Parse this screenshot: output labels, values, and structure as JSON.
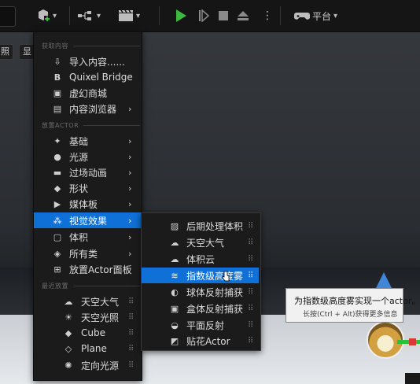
{
  "toolbar": {
    "items": [
      {
        "icon": "add-actor-icon"
      },
      {
        "icon": "blueprint-icon"
      },
      {
        "icon": "cinematics-icon"
      }
    ],
    "play_controls": [
      "play-icon",
      "step-icon",
      "stop-icon",
      "eject-icon",
      "more-options-icon"
    ],
    "platforms_label": "平台"
  },
  "viewport_buttons": [
    "照",
    "显"
  ],
  "main_menu": {
    "sections": {
      "get_content": "获取内容",
      "place_actor": "放置ACTOR",
      "recently_placed": "最近放置"
    },
    "get_content_items": [
      {
        "label": "导入内容......",
        "icon": "import-icon"
      },
      {
        "label": "Quixel Bridge",
        "icon": "bridge-icon"
      },
      {
        "label": "虚幻商城",
        "icon": "marketplace-icon"
      },
      {
        "label": "内容浏览器",
        "icon": "content-browser-icon",
        "has_submenu": true
      }
    ],
    "place_actor_items": [
      {
        "label": "基础",
        "icon": "basic-icon",
        "has_submenu": true
      },
      {
        "label": "光源",
        "icon": "light-icon",
        "has_submenu": true
      },
      {
        "label": "过场动画",
        "icon": "cinematic-icon",
        "has_submenu": true
      },
      {
        "label": "形状",
        "icon": "shape-icon",
        "has_submenu": true
      },
      {
        "label": "媒体板",
        "icon": "media-icon",
        "has_submenu": true
      },
      {
        "label": "视觉效果",
        "icon": "visual-effects-icon",
        "has_submenu": true,
        "active": true
      },
      {
        "label": "体积",
        "icon": "volume-icon",
        "has_submenu": true
      },
      {
        "label": "所有类",
        "icon": "all-classes-icon",
        "has_submenu": true
      },
      {
        "label": "放置Actor面板",
        "icon": "place-panel-icon"
      }
    ],
    "recent_items": [
      {
        "label": "天空大气",
        "icon": "sky-atmosphere-icon"
      },
      {
        "label": "天空光照",
        "icon": "sky-light-icon"
      },
      {
        "label": "Cube",
        "icon": "cube-icon"
      },
      {
        "label": "Plane",
        "icon": "plane-icon"
      },
      {
        "label": "定向光源",
        "icon": "directional-light-icon"
      }
    ]
  },
  "sub_menu": {
    "items": [
      {
        "label": "后期处理体积",
        "icon": "post-process-icon"
      },
      {
        "label": "天空大气",
        "icon": "sky-atmosphere-icon"
      },
      {
        "label": "体积云",
        "icon": "volumetric-cloud-icon"
      },
      {
        "label": "指数级高度雾",
        "icon": "height-fog-icon",
        "active": true
      },
      {
        "label": "球体反射捕获",
        "icon": "sphere-reflection-icon"
      },
      {
        "label": "盒体反射捕获",
        "icon": "box-reflection-icon"
      },
      {
        "label": "平面反射",
        "icon": "planar-reflection-icon"
      },
      {
        "label": "贴花Actor",
        "icon": "decal-icon"
      }
    ]
  },
  "tooltip": {
    "title": "为指数级高度雾实现一个actor。",
    "hint": "长按(Ctrl + Alt)获得更多信息"
  },
  "colors": {
    "accent": "#0f70d7",
    "play_green": "#3fb83f"
  }
}
